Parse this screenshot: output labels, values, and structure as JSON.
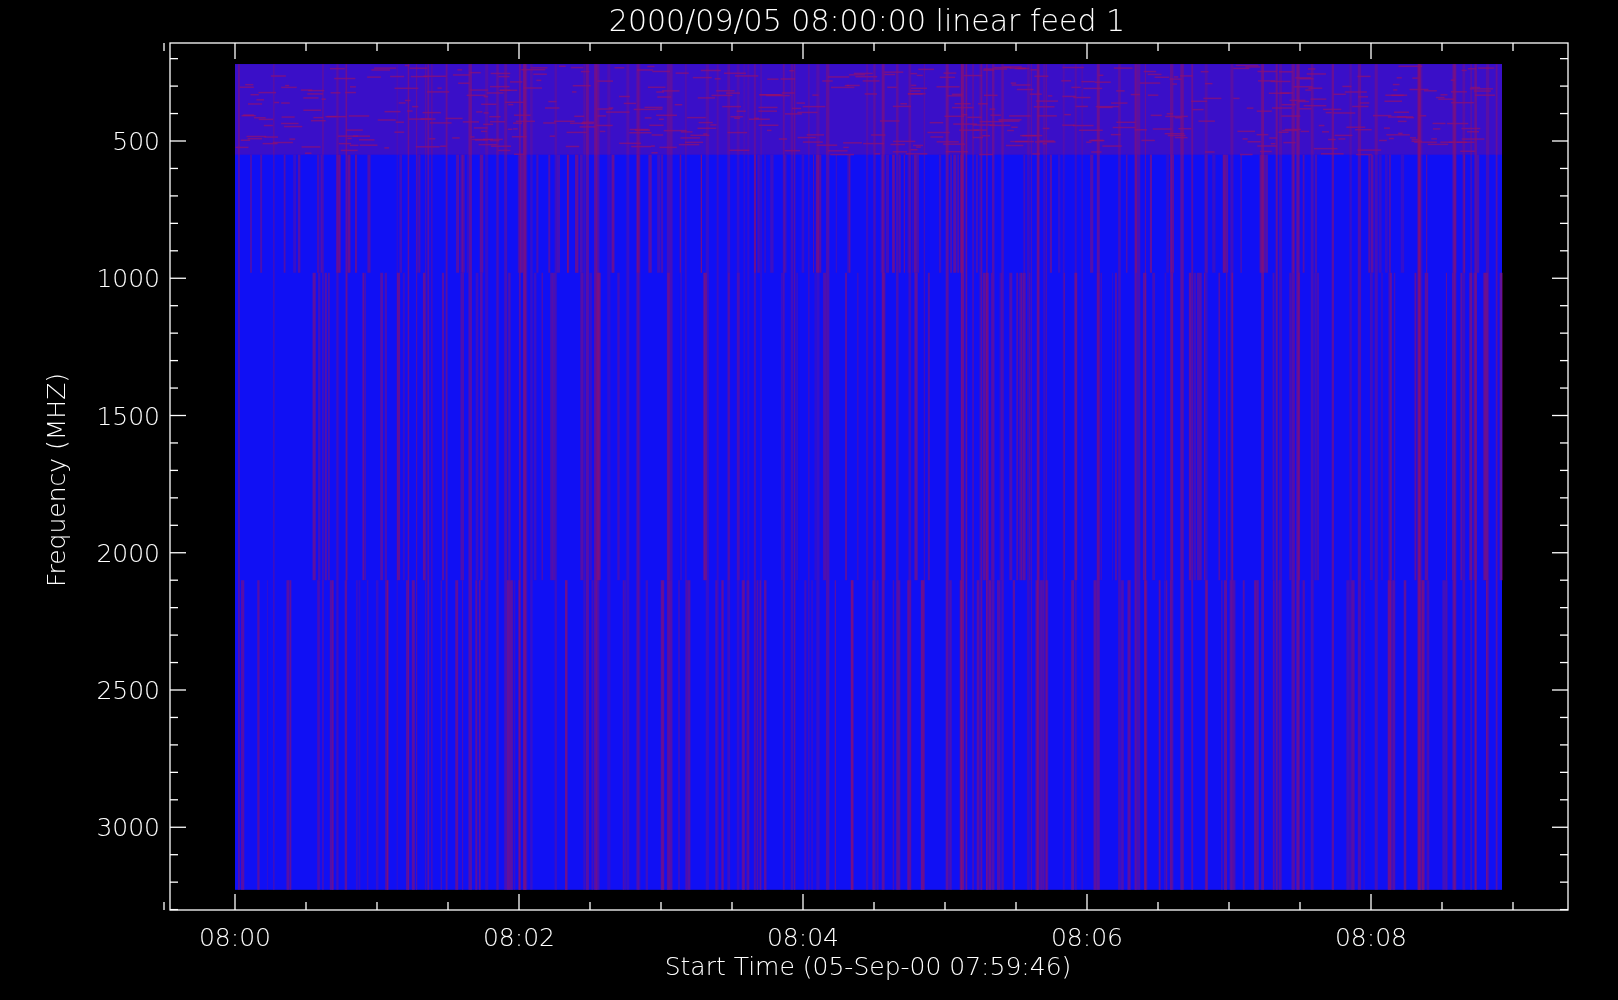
{
  "title": "2000/09/05 08:00:00 linear feed 1",
  "y_axis": {
    "label": "Frequency (MHZ)",
    "ticks": [
      "500",
      "1000",
      "1500",
      "2000",
      "2500",
      "3000"
    ]
  },
  "x_axis": {
    "label": "Start Time (05-Sep-00 07:59:46)",
    "ticks": [
      "08:00",
      "08:02",
      "08:04",
      "08:06",
      "08:08"
    ]
  }
}
